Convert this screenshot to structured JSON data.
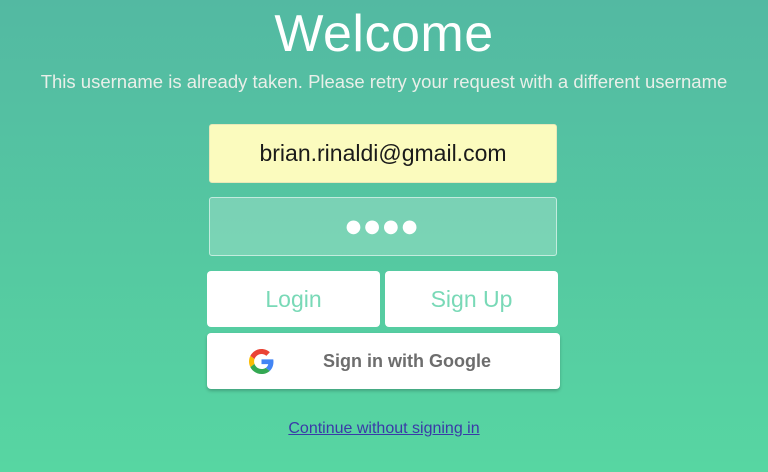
{
  "header": {
    "title": "Welcome",
    "error_message": "This username is already taken. Please retry your request with a different username"
  },
  "form": {
    "email_value": "brian.rinaldi@gmail.com",
    "password_display": "●●●●"
  },
  "buttons": {
    "login_label": "Login",
    "signup_label": "Sign Up",
    "google_label": "Sign in with Google",
    "google_icon": "google-g-icon"
  },
  "footer": {
    "continue_label": "Continue without signing in"
  },
  "colors": {
    "background_top": "#53b9a2",
    "background_bottom": "#57d6a2",
    "accent_text": "#79d9b7",
    "email_field_bg": "#fbfbbe",
    "link": "#3a3aa8"
  }
}
